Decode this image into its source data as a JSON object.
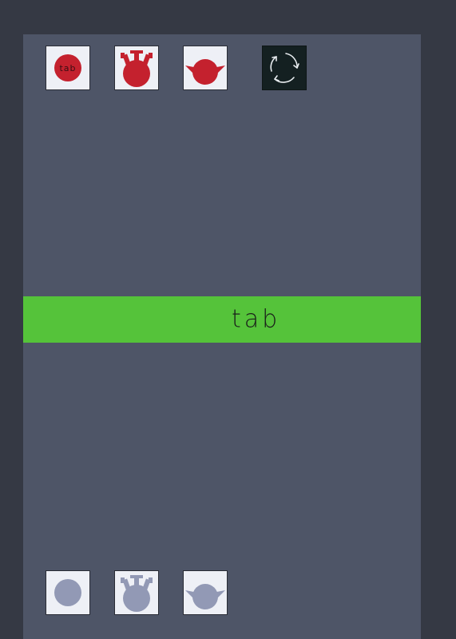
{
  "colors": {
    "background": "#353944",
    "panel": "#4e5567",
    "banner": "#55c33a",
    "active_shape": "#c4212e",
    "inactive_shape": "#9299b5",
    "tile_bg": "#eef0f6",
    "reset_bg": "#142021"
  },
  "top_tiles": [
    {
      "icon": "circle-tab-icon",
      "label": "tab"
    },
    {
      "icon": "antlered-head-icon"
    },
    {
      "icon": "eared-head-icon"
    },
    {
      "icon": "reset-arrows-icon"
    }
  ],
  "banner": {
    "word": "tab"
  },
  "bottom_tiles": [
    {
      "icon": "circle-icon"
    },
    {
      "icon": "antlered-head-icon"
    },
    {
      "icon": "eared-head-icon"
    }
  ]
}
